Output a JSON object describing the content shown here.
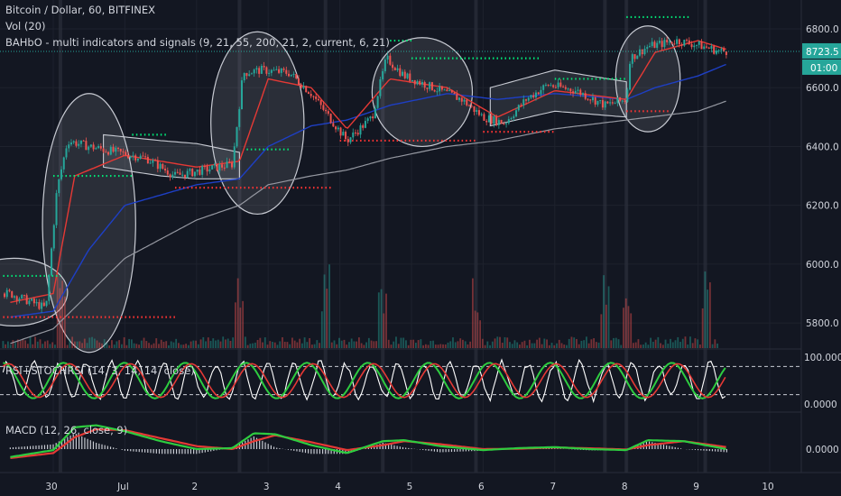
{
  "header": {
    "symbol_line": "Bitcoin / Dollar, 60, BITFINEX",
    "volume_line": "Vol (20)",
    "indicator_line": "BAHbO - multi indicators and signals (9, 21, 55, 200, 21, 2, current, 6, 21)"
  },
  "rsi_pane": {
    "label": "RSI+STOCHRSI (14, 3, 14, 14, close)"
  },
  "macd_pane": {
    "label": "MACD (12, 26, close, 9)"
  },
  "price_badges": {
    "last_price": "8723.5",
    "countdown": "01:00"
  },
  "colors": {
    "background": "#131722",
    "up": "#26a69a",
    "down": "#ef5350",
    "ema_fast": "#e53935",
    "ema_mid": "#1e3fc4",
    "ema_slow": "#9598a1",
    "band": "#c8cbd3",
    "buy_signal": "#00e676",
    "sell_signal": "#ff3333",
    "stoch_k": "#ffffff",
    "stoch_rsi": "#2ecc40",
    "stoch_d": "#e53935"
  },
  "chart_data": [
    {
      "type": "candlestick",
      "title": "Bitcoin / Dollar, 60, BITFINEX",
      "ylim": [
        5700,
        6850
      ],
      "yticks": [
        "6800.0",
        "6600.0",
        "6400.0",
        "6200.0",
        "6000.0",
        "5800.0"
      ],
      "ytick_values": [
        6800,
        6600,
        6400,
        6200,
        6000,
        5800
      ],
      "xlim": [
        29.3,
        10.4
      ],
      "xticks": [
        "30",
        "Jul",
        "2",
        "3",
        "4",
        "5",
        "6",
        "7",
        "8",
        "9",
        "10"
      ],
      "xtick_day_index": [
        0,
        1,
        2,
        3,
        4,
        5,
        6,
        7,
        8,
        9,
        10
      ],
      "close_anchors": [
        [
          -0.6,
          5900
        ],
        [
          -0.4,
          5880
        ],
        [
          -0.1,
          5850
        ],
        [
          0.05,
          6250
        ],
        [
          0.2,
          6420
        ],
        [
          0.5,
          6400
        ],
        [
          0.9,
          6380
        ],
        [
          1.3,
          6360
        ],
        [
          1.7,
          6300
        ],
        [
          2.1,
          6320
        ],
        [
          2.5,
          6340
        ],
        [
          2.65,
          6650
        ],
        [
          2.9,
          6660
        ],
        [
          3.3,
          6650
        ],
        [
          3.6,
          6580
        ],
        [
          3.85,
          6500
        ],
        [
          4.1,
          6420
        ],
        [
          4.45,
          6500
        ],
        [
          4.65,
          6700
        ],
        [
          4.9,
          6640
        ],
        [
          5.3,
          6600
        ],
        [
          5.7,
          6560
        ],
        [
          6.0,
          6500
        ],
        [
          6.3,
          6480
        ],
        [
          6.6,
          6560
        ],
        [
          6.9,
          6610
        ],
        [
          7.3,
          6590
        ],
        [
          7.7,
          6540
        ],
        [
          8.0,
          6560
        ],
        [
          8.05,
          6700
        ],
        [
          8.3,
          6740
        ],
        [
          8.7,
          6760
        ],
        [
          9.0,
          6745
        ],
        [
          9.3,
          6723.5
        ],
        [
          9.4,
          6723.5
        ]
      ],
      "last_price": 6723.5,
      "overlays": {
        "ema_fast_anchors": [
          [
            -0.6,
            5870
          ],
          [
            0.0,
            5900
          ],
          [
            0.3,
            6300
          ],
          [
            1.0,
            6370
          ],
          [
            2.0,
            6330
          ],
          [
            2.6,
            6350
          ],
          [
            3.0,
            6630
          ],
          [
            3.6,
            6600
          ],
          [
            4.1,
            6460
          ],
          [
            4.7,
            6630
          ],
          [
            5.5,
            6600
          ],
          [
            6.2,
            6500
          ],
          [
            7.0,
            6590
          ],
          [
            8.0,
            6560
          ],
          [
            8.4,
            6720
          ],
          [
            9.0,
            6760
          ],
          [
            9.4,
            6730
          ]
        ],
        "ema_mid_anchors": [
          [
            -0.6,
            5820
          ],
          [
            0.0,
            5840
          ],
          [
            0.5,
            6050
          ],
          [
            1.0,
            6200
          ],
          [
            2.0,
            6270
          ],
          [
            2.6,
            6290
          ],
          [
            3.0,
            6400
          ],
          [
            3.6,
            6470
          ],
          [
            4.1,
            6490
          ],
          [
            4.7,
            6540
          ],
          [
            5.5,
            6580
          ],
          [
            6.2,
            6560
          ],
          [
            7.0,
            6580
          ],
          [
            8.0,
            6560
          ],
          [
            8.4,
            6600
          ],
          [
            9.0,
            6640
          ],
          [
            9.4,
            6680
          ]
        ],
        "ema_slow_anchors": [
          [
            -0.6,
            5730
          ],
          [
            0.0,
            5780
          ],
          [
            1.0,
            6020
          ],
          [
            2.0,
            6150
          ],
          [
            2.6,
            6200
          ],
          [
            3.0,
            6270
          ],
          [
            3.6,
            6300
          ],
          [
            4.1,
            6320
          ],
          [
            4.7,
            6360
          ],
          [
            5.5,
            6400
          ],
          [
            6.2,
            6420
          ],
          [
            7.0,
            6460
          ],
          [
            8.0,
            6490
          ],
          [
            9.0,
            6520
          ],
          [
            9.4,
            6555
          ]
        ]
      },
      "bollinger_ellipses": [
        {
          "center_day": -0.55,
          "half_width_days": 0.75,
          "high": 6020,
          "low": 5790
        },
        {
          "center_day": 0.5,
          "half_width_days": 0.65,
          "high": 6580,
          "low": 5700
        },
        {
          "center_day": 2.85,
          "half_width_days": 0.65,
          "high": 6790,
          "low": 6170
        },
        {
          "center_day": 5.15,
          "half_width_days": 0.7,
          "high": 6770,
          "low": 6400
        },
        {
          "center_day": 8.3,
          "half_width_days": 0.45,
          "high": 6810,
          "low": 6450
        }
      ],
      "bollinger_bands": [
        {
          "from": 0.7,
          "to": 2.6,
          "upper": [
            [
              0.7,
              6440
            ],
            [
              1.5,
              6420
            ],
            [
              2.0,
              6410
            ],
            [
              2.6,
              6380
            ]
          ],
          "lower": [
            [
              0.7,
              6330
            ],
            [
              1.5,
              6300
            ],
            [
              2.0,
              6290
            ],
            [
              2.6,
              6290
            ]
          ]
        },
        {
          "from": 6.1,
          "to": 8.0,
          "upper": [
            [
              6.1,
              6600
            ],
            [
              7.0,
              6660
            ],
            [
              8.0,
              6620
            ]
          ],
          "lower": [
            [
              6.1,
              6470
            ],
            [
              7.0,
              6520
            ],
            [
              8.0,
              6500
            ]
          ]
        }
      ],
      "support_resistance_lines": [
        {
          "kind": "buy",
          "day_from": -0.7,
          "day_to": 0.1,
          "level": 5960
        },
        {
          "kind": "sell",
          "day_from": -0.7,
          "day_to": 1.7,
          "level": 5820
        },
        {
          "kind": "buy",
          "day_from": 0.0,
          "day_to": 1.1,
          "level": 6300
        },
        {
          "kind": "buy",
          "day_from": 1.1,
          "day_to": 1.6,
          "level": 6440
        },
        {
          "kind": "sell",
          "day_from": 1.7,
          "day_to": 3.9,
          "level": 6260
        },
        {
          "kind": "buy",
          "day_from": 2.7,
          "day_to": 3.3,
          "level": 6390
        },
        {
          "kind": "buy",
          "day_from": 4.7,
          "day_to": 5.0,
          "level": 6760
        },
        {
          "kind": "sell",
          "day_from": 4.0,
          "day_to": 5.9,
          "level": 6420
        },
        {
          "kind": "buy",
          "day_from": 5.0,
          "day_to": 6.8,
          "level": 6700
        },
        {
          "kind": "sell",
          "day_from": 6.0,
          "day_to": 7.0,
          "level": 6450
        },
        {
          "kind": "buy",
          "day_from": 7.0,
          "day_to": 8.0,
          "level": 6630
        },
        {
          "kind": "sell",
          "day_from": 8.0,
          "day_to": 8.6,
          "level": 6520
        },
        {
          "kind": "buy",
          "day_from": 8.0,
          "day_to": 8.9,
          "level": 6840
        }
      ],
      "signal_columns_day": [
        0.1,
        2.6,
        3.8,
        4.6,
        5.9,
        7.7,
        8.0,
        9.1
      ],
      "horizontal_price_line": 6723.5
    },
    {
      "type": "oscillator",
      "title": "RSI+STOCHRSI (14, 3, 14, 14, close)",
      "yticks": [
        "100.0000",
        "0.0000"
      ],
      "ytick_values": [
        100,
        0
      ],
      "ylim": [
        0,
        100
      ],
      "series": [
        {
          "color_key": "stoch_k",
          "values": []
        },
        {
          "color_key": "stoch_rsi",
          "values": []
        },
        {
          "color_key": "stoch_d",
          "values": []
        }
      ],
      "guide_levels": [
        80,
        20
      ]
    },
    {
      "type": "macd",
      "title": "MACD (12, 26, close, 9)",
      "yticks": [
        "0.0000"
      ],
      "ytick_values": [
        0
      ],
      "macd_anchors": [
        [
          -0.6,
          -40
        ],
        [
          0.0,
          -5
        ],
        [
          0.3,
          110
        ],
        [
          0.6,
          120
        ],
        [
          1.0,
          90
        ],
        [
          1.5,
          40
        ],
        [
          2.0,
          0
        ],
        [
          2.5,
          5
        ],
        [
          2.8,
          80
        ],
        [
          3.1,
          75
        ],
        [
          3.6,
          20
        ],
        [
          4.1,
          -20
        ],
        [
          4.6,
          40
        ],
        [
          4.9,
          45
        ],
        [
          5.4,
          15
        ],
        [
          6.0,
          -5
        ],
        [
          6.5,
          5
        ],
        [
          7.0,
          10
        ],
        [
          7.5,
          0
        ],
        [
          8.0,
          -5
        ],
        [
          8.3,
          45
        ],
        [
          8.8,
          40
        ],
        [
          9.4,
          0
        ]
      ],
      "signal_anchors": [
        [
          -0.6,
          -45
        ],
        [
          0.0,
          -20
        ],
        [
          0.3,
          60
        ],
        [
          0.6,
          100
        ],
        [
          1.0,
          95
        ],
        [
          1.5,
          55
        ],
        [
          2.0,
          15
        ],
        [
          2.5,
          0
        ],
        [
          2.8,
          40
        ],
        [
          3.1,
          70
        ],
        [
          3.6,
          35
        ],
        [
          4.1,
          -5
        ],
        [
          4.6,
          20
        ],
        [
          4.9,
          40
        ],
        [
          5.4,
          25
        ],
        [
          6.0,
          0
        ],
        [
          6.5,
          2
        ],
        [
          7.0,
          8
        ],
        [
          7.5,
          4
        ],
        [
          8.0,
          -2
        ],
        [
          8.3,
          20
        ],
        [
          8.8,
          40
        ],
        [
          9.4,
          10
        ]
      ]
    }
  ]
}
